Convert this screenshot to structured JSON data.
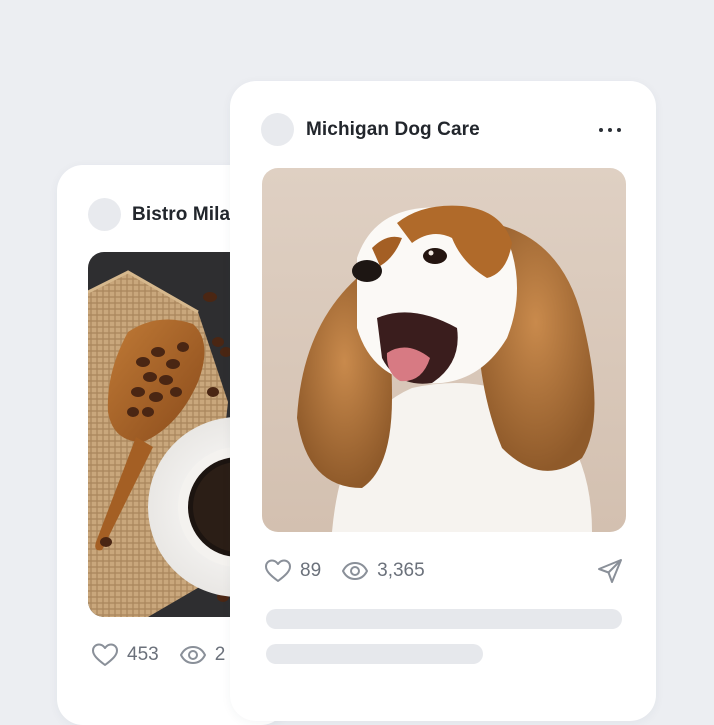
{
  "posts": [
    {
      "author": "Bistro Mila",
      "likes": "453",
      "views": "2"
    },
    {
      "author": "Michigan Dog Care",
      "likes": "89",
      "views": "3,365"
    }
  ],
  "icons": {
    "like": "heart-icon",
    "views": "eye-icon",
    "share": "send-icon",
    "menu": "more-horizontal-icon"
  },
  "colors": {
    "background": "#eceef2",
    "card": "#ffffff",
    "placeholder": "#e6e8ec",
    "icon": "#8a9099"
  }
}
